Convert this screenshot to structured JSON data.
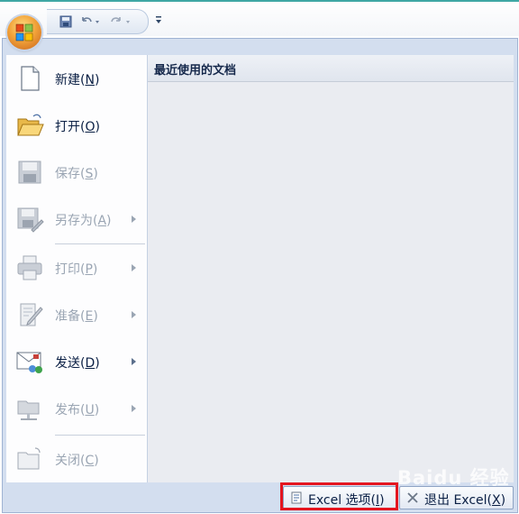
{
  "menu": {
    "items": [
      {
        "label": "新建(N)",
        "icon": "new-document-icon",
        "enabled": true,
        "submenu": false
      },
      {
        "label": "打开(O)",
        "icon": "open-folder-icon",
        "enabled": true,
        "submenu": false
      },
      {
        "label": "保存(S)",
        "icon": "save-icon",
        "enabled": false,
        "submenu": false
      },
      {
        "label": "另存为(A)",
        "icon": "save-as-icon",
        "enabled": false,
        "submenu": true
      },
      {
        "label": "打印(P)",
        "icon": "print-icon",
        "enabled": false,
        "submenu": true
      },
      {
        "label": "准备(E)",
        "icon": "prepare-icon",
        "enabled": false,
        "submenu": true
      },
      {
        "label": "发送(D)",
        "icon": "send-icon",
        "enabled": true,
        "submenu": true
      },
      {
        "label": "发布(U)",
        "icon": "publish-icon",
        "enabled": false,
        "submenu": true
      },
      {
        "label": "关闭(C)",
        "icon": "close-folder-icon",
        "enabled": false,
        "submenu": false
      }
    ]
  },
  "recent": {
    "title": "最近使用的文档"
  },
  "footer": {
    "options_label": "Excel 选项(I)",
    "exit_label": "退出 Excel(X)"
  },
  "watermark": {
    "text": "Baidu 经验"
  },
  "colors": {
    "highlight": "#e4151f",
    "accent": "#3fa7a4"
  }
}
